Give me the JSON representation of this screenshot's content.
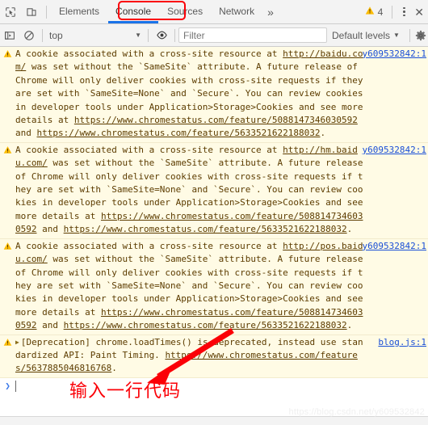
{
  "window": {
    "app": "Chrome DevTools"
  },
  "tabbar": {
    "inspect_icon": "inspect-element-icon",
    "device_icon": "device-toolbar-icon",
    "tabs": [
      {
        "label": "Elements",
        "active": false
      },
      {
        "label": "Console",
        "active": true
      },
      {
        "label": "Sources",
        "active": false
      },
      {
        "label": "Network",
        "active": false
      }
    ],
    "more_label": "»",
    "warning_count": "4",
    "warning_icon": "warning-triangle-icon",
    "kebab_icon": "more-options-icon",
    "close_label": "✕"
  },
  "filterbar": {
    "sidebar_icon": "console-sidebar-icon",
    "clear_icon": "clear-console-icon",
    "context": "top",
    "context_caret": "▼",
    "eye_icon": "live-expression-eye-icon",
    "filter_placeholder": "Filter",
    "filter_value": "",
    "levels_label": "Default levels",
    "levels_caret": "▼",
    "settings_icon": "settings-gear-icon"
  },
  "console": {
    "messages": [
      {
        "level": "warning",
        "icon": "warning-triangle-icon",
        "expandable": false,
        "source": "y609532842:1",
        "parts": [
          {
            "t": "A cookie associated with a cross-site resource at "
          },
          {
            "t": "http://baidu.com/",
            "link": true
          },
          {
            "t": " was set without the `SameSite` attribute. A future release of Chrome will only deliver cookies with cross-site requests if they are set with `SameSite=None` and `Secure`. You can review cookies in developer tools under Application>Storage>Cookies and see more details at "
          },
          {
            "t": "https://www.chromestatus.com/feature/5088147346030592",
            "link": true
          },
          {
            "t": " and "
          },
          {
            "t": "https://www.chromestatus.com/feature/5633521622188032",
            "link": true
          },
          {
            "t": "."
          }
        ]
      },
      {
        "level": "warning",
        "icon": "warning-triangle-icon",
        "expandable": false,
        "source": "y609532842:1",
        "parts": [
          {
            "t": "A cookie associated with a cross-site resource at "
          },
          {
            "t": "http://hm.baidu.com/",
            "link": true
          },
          {
            "t": " was set without the `SameSite` attribute. A future release of Chrome will only deliver cookies with cross-site requests if they are set with `SameSite=None` and `Secure`. You can review cookies in developer tools under Application>Storage>Cookies and see more details at "
          },
          {
            "t": "https://www.chromestatus.com/feature/5088147346030592",
            "link": true
          },
          {
            "t": " and "
          },
          {
            "t": "https://www.chromestatus.com/feature/5633521622188032",
            "link": true
          },
          {
            "t": "."
          }
        ]
      },
      {
        "level": "warning",
        "icon": "warning-triangle-icon",
        "expandable": false,
        "source": "y609532842:1",
        "parts": [
          {
            "t": "A cookie associated with a cross-site resource at "
          },
          {
            "t": "http://pos.baidu.com/",
            "link": true
          },
          {
            "t": " was set without the `SameSite` attribute. A future release of Chrome will only deliver cookies with cross-site requests if they are set with `SameSite=None` and `Secure`. You can review cookies in developer tools under Application>Storage>Cookies and see more details at "
          },
          {
            "t": "https://www.chromestatus.com/feature/5088147346030592",
            "link": true
          },
          {
            "t": " and "
          },
          {
            "t": "https://www.chromestatus.com/feature/5633521622188032",
            "link": true
          },
          {
            "t": "."
          }
        ]
      },
      {
        "level": "warning",
        "icon": "warning-triangle-icon",
        "expandable": true,
        "expand_glyph": "▶",
        "source": "blog.js:1",
        "parts": [
          {
            "t": "[Deprecation] chrome.loadTimes() is deprecated, instead use standardized API: Paint Timing. "
          },
          {
            "t": "https://www.chromestatus.com/features/5637885046816768",
            "link": true
          },
          {
            "t": "."
          }
        ]
      }
    ],
    "prompt_chevron": "❯"
  },
  "annotations": {
    "console_tab_highlight": "console-tab-red-box",
    "note_text": "输入一行代码",
    "arrow": "red-arrow-pointing-to-console-prompt",
    "accent_red": "#fb0007"
  },
  "watermark": {
    "text": "https://blog.csdn.net/y609532842"
  }
}
